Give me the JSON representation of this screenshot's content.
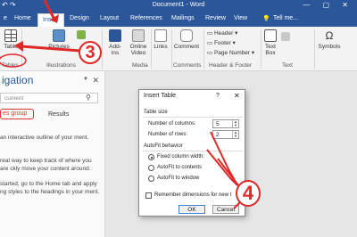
{
  "window": {
    "title": "Document1 - Word"
  },
  "tabs": {
    "file": "e",
    "home": "Home",
    "insert": "Insert",
    "design": "Design",
    "layout": "Layout",
    "references": "References",
    "mailings": "Mailings",
    "review": "Review",
    "view": "View",
    "tellme": "Tell me..."
  },
  "ribbon": {
    "table": "Table",
    "tables_group": "Tables",
    "pictures": "Pictures",
    "illustrations_group": "Illustrations",
    "addins": "Add-ins",
    "online_video": "Online Video",
    "media_group": "Media",
    "links": "Links",
    "comment": "Comment",
    "comments_group": "Comments",
    "header": "Header",
    "footer": "Footer",
    "page_number": "Page Number",
    "header_footer_group": "Header & Footer",
    "text_box": "Text Box",
    "text_group": "Text",
    "symbols": "Symbols"
  },
  "nav": {
    "title": "igation",
    "search_placeholder": "cument",
    "tab_headings": "es group",
    "tab_results": "Results",
    "text1": "an interactive outline of your ment.",
    "text2": "reat way to keep track of where you are ckly move your content around.",
    "text3": "started, go to the Home tab and apply ng styles to the headings in your ment."
  },
  "dialog": {
    "title": "Insert Table",
    "help": "?",
    "close": "✕",
    "table_size": "Table size",
    "num_columns_label": "Number of columns:",
    "num_columns_value": "5",
    "num_rows_label": "Number of rows:",
    "num_rows_value": "2",
    "autofit_behavior": "AutoFit behavior",
    "fixed_width": "Fixed column width:",
    "autofit_contents": "AutoFit to contents",
    "autofit_window": "AutoFit to window",
    "remember": "Remember dimensions for new t",
    "ok": "OK",
    "cancel": "Cancel"
  },
  "annotations": {
    "step3": "3",
    "step4": "4"
  },
  "colors": {
    "word_blue": "#2b579a",
    "annotation_red": "#e02828"
  }
}
